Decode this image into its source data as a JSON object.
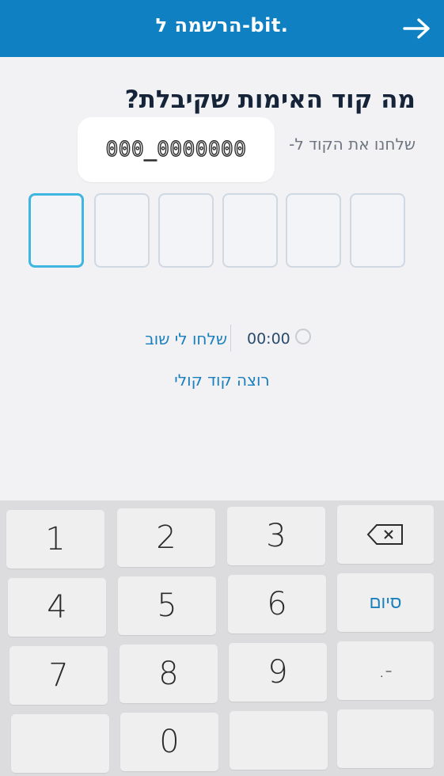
{
  "header": {
    "title": "הרשמה ל-bit.",
    "back_icon": "arrow-right-icon"
  },
  "verification": {
    "heading": "מה קוד האימות שקיבלת?",
    "sent_to": "שלחנו את הקוד ל-",
    "phone": "000_0000000",
    "code_digits": [
      "",
      "",
      "",
      "",
      "",
      ""
    ],
    "active_index": 0
  },
  "actions": {
    "timer": "00:00",
    "resend": "שלחו לי שוב",
    "voice_code": "רוצה קוד קולי"
  },
  "keypad": {
    "keys": [
      "1",
      "2",
      "3",
      "4",
      "5",
      "6",
      "7",
      "8",
      "9",
      "0"
    ],
    "done_label": "סיום",
    "symbol_label": ".-",
    "backspace_icon": "backspace-icon"
  },
  "colors": {
    "brand_blue": "#0f81c3",
    "link_blue": "#1a7fbd",
    "active_border": "#3fb6e0"
  }
}
